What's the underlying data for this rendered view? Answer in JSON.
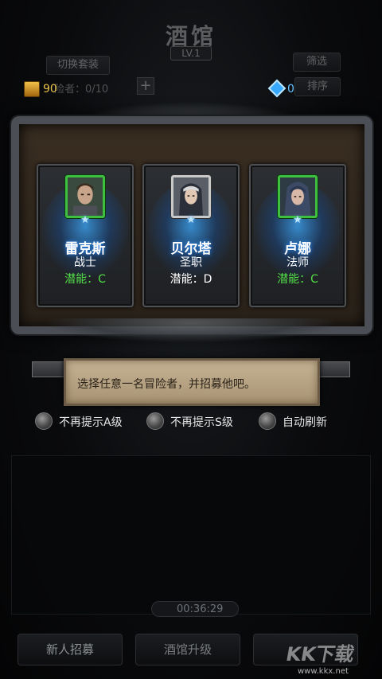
{
  "header": {
    "title": "酒馆",
    "level": "LV.1",
    "switch_outfit": "切换套装",
    "filter": "筛选",
    "sort": "排序",
    "adventurer_count": "险者：0/10",
    "gold": "90",
    "gems": "0"
  },
  "heroes": [
    {
      "name": "雷克斯",
      "class": "战士",
      "potential": "潜能：C",
      "frame_color": "green",
      "stars": "★",
      "portrait": "warrior-portrait"
    },
    {
      "name": "贝尔塔",
      "class": "圣职",
      "potential": "潜能：D",
      "frame_color": "white",
      "stars": "★",
      "portrait": "priest-portrait"
    },
    {
      "name": "卢娜",
      "class": "法师",
      "potential": "潜能：C",
      "frame_color": "green",
      "stars": "★",
      "portrait": "mage-portrait"
    }
  ],
  "tooltip": {
    "text": "选择任意一名冒险者，并招募他吧。"
  },
  "options": [
    {
      "label": "不再提示A级"
    },
    {
      "label": "不再提示S级"
    },
    {
      "label": "自动刷新"
    }
  ],
  "timer": "00:36:29",
  "bottom": {
    "recruit": "新人招募",
    "upgrade": "酒馆升级"
  },
  "watermark": {
    "text": "KK下载",
    "url": "www.kkx.net"
  },
  "colors": {
    "potential_c": "#52e04a",
    "potential_d": "#ffffff",
    "hero_glow": "#2a8cff",
    "tooltip_bg": "#b8a483"
  }
}
